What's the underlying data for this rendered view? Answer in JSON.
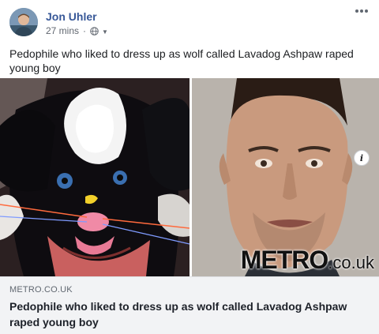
{
  "post": {
    "author": "Jon Uhler",
    "timestamp": "27 mins",
    "separator": "·",
    "privacy_icon": "globe-icon",
    "caption": "Pedophile who liked to dress up as wolf called Lavadog Ashpaw raped young boy"
  },
  "link_preview": {
    "domain": "METRO.CO.UK",
    "title": "Pedophile who liked to dress up as wolf called Lavadog Ashpaw raped young boy",
    "watermark_main": "METRO",
    "watermark_sub": ".co.uk",
    "info_label": "i"
  },
  "colors": {
    "author_link": "#385898",
    "meta_text": "#616770",
    "card_background": "#f2f3f5"
  }
}
